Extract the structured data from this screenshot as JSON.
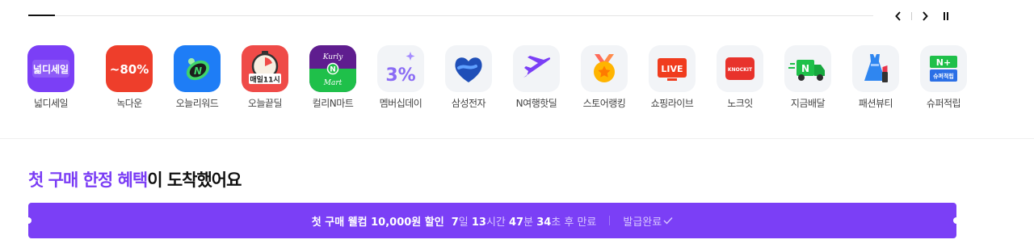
{
  "carousel": {
    "progress_fraction": 0.032,
    "prev_icon": "chevron-left-icon",
    "next_icon": "chevron-right-icon",
    "pause_icon": "pause-icon"
  },
  "shortcuts": [
    {
      "label": "넓디세일",
      "icon": "nubdi-sale-icon",
      "badge": "넓디세일",
      "bg": "#7b3ff6"
    },
    {
      "label": "녹다운",
      "icon": "knockdown-80-icon",
      "badge": "~80%",
      "bg": "#ee3e2b"
    },
    {
      "label": "오늘리워드",
      "icon": "n-coin-reward-icon",
      "bg": "#1e7df6"
    },
    {
      "label": "오늘끝딜",
      "icon": "timer-deal-icon",
      "badge": "매일11시",
      "bg": "#ef4b48"
    },
    {
      "label": "컬리N마트",
      "icon": "kurly-n-mart-icon",
      "badge_top": "Kurly",
      "badge_mid": "N",
      "badge_bottom": "Mart",
      "bg": "#5f1d8f"
    },
    {
      "label": "멤버십데이",
      "icon": "membership-3-percent-icon",
      "badge": "3%",
      "bg": "#f2f4f7"
    },
    {
      "label": "삼성전자",
      "icon": "samsung-heart-icon",
      "bg": "#f2f4f7"
    },
    {
      "label": "N여행핫딜",
      "icon": "airplane-icon",
      "bg": "#f2f4f7"
    },
    {
      "label": "스토어랭킹",
      "icon": "medal-icon",
      "bg": "#f2f4f7"
    },
    {
      "label": "쇼핑라이브",
      "icon": "live-tv-icon",
      "badge": "LIVE",
      "bg": "#f2f4f7"
    },
    {
      "label": "노크잇",
      "icon": "knockit-icon",
      "badge": "KNOCKIT",
      "bg": "#f2f4f7"
    },
    {
      "label": "지금배달",
      "icon": "delivery-truck-icon",
      "badge": "N",
      "bg": "#f2f4f7"
    },
    {
      "label": "패션뷰티",
      "icon": "dress-lipstick-icon",
      "bg": "#f2f4f7"
    },
    {
      "label": "슈퍼적립",
      "icon": "super-points-icon",
      "badge_top": "N+",
      "badge_bottom": "슈퍼적립",
      "bg": "#f2f4f7"
    }
  ],
  "section": {
    "title_highlight": "첫 구매 한정 혜택",
    "title_rest": "이 도착했어요"
  },
  "coupon": {
    "name": "첫 구매 웰컴 10,000원 할인",
    "days": "7",
    "days_unit": "일 ",
    "hours": "13",
    "hours_unit": "시간 ",
    "minutes": "47",
    "minutes_unit": "분 ",
    "seconds": "34",
    "seconds_unit": "초 후 만료",
    "issued_label": "발급완료",
    "issued_icon": "check-icon"
  },
  "colors": {
    "accent": "#7b3ff6",
    "title_accent": "#7a3cf5"
  }
}
